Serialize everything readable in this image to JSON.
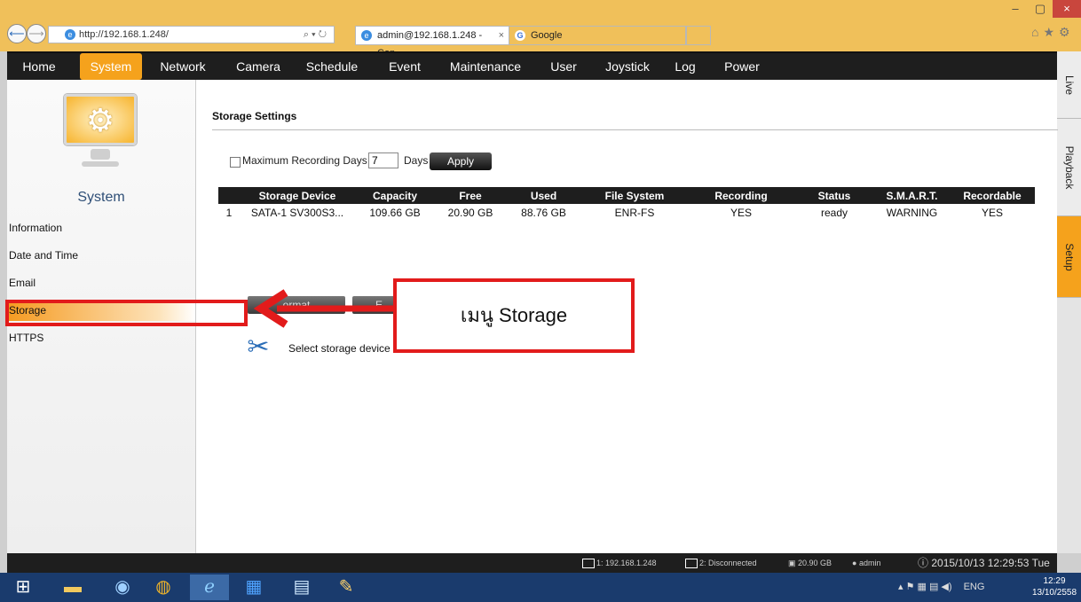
{
  "browser": {
    "url": "http://192.168.1.248/",
    "address_tools": "⌕ ▾ ↻",
    "tabs": [
      {
        "label": "admin@192.168.1.248 - Con...",
        "close": "×"
      },
      {
        "label": "Google"
      }
    ],
    "window_buttons": {
      "minimize": "–",
      "maximize": "▢",
      "close": "×"
    },
    "icons": [
      "home-icon",
      "star-icon",
      "gear-icon"
    ]
  },
  "topnav": {
    "items": [
      "Home",
      "System",
      "Network",
      "Camera",
      "Schedule",
      "Event",
      "Maintenance",
      "User",
      "Joystick",
      "Log",
      "Power"
    ],
    "active": "System"
  },
  "side_tabs": {
    "items": [
      "Live",
      "Playback",
      "Setup"
    ],
    "active": "Setup"
  },
  "left_panel": {
    "title": "System",
    "menu": [
      "Information",
      "Date and Time",
      "Email",
      "Storage",
      "HTTPS"
    ],
    "active": "Storage"
  },
  "content": {
    "section_title": "Storage Settings",
    "max_days_label": "Maximum Recording Days",
    "max_days_value": "7",
    "days_unit": "Days",
    "apply_label": "Apply",
    "table": {
      "headers": [
        "",
        "Storage Device",
        "Capacity",
        "Free",
        "Used",
        "File System",
        "Recording",
        "Status",
        "S.M.A.R.T.",
        "Recordable"
      ],
      "rows": [
        [
          "1",
          "SATA-1 SV300S3...",
          "109.66 GB",
          "20.90 GB",
          "88.76 GB",
          "ENR-FS",
          "YES",
          "ready",
          "WARNING",
          "YES"
        ]
      ]
    },
    "format_button_label": "ormat",
    "second_button_label": "E",
    "hint_text": "Select storage device t"
  },
  "annotation": {
    "text": "เมนู Storage",
    "color": "#e21b1b"
  },
  "status_bar": {
    "connection": "1: 192.168.1.248",
    "second_connection": "2: Disconnected",
    "free_space": "20.90 GB",
    "user": "admin",
    "datetime": "2015/10/13 12:29:53 Tue"
  },
  "taskbar": {
    "tray_lang": "ENG",
    "tray_icons": "▴ ⚑ ▦ ▤ ◀)",
    "clock_time": "12:29",
    "clock_date": "13/10/2558"
  },
  "colors": {
    "accent": "#f5a21c",
    "nav_bg": "#1e1e1e",
    "browser_chrome": "#f0c05a",
    "annotation": "#e21b1b"
  }
}
